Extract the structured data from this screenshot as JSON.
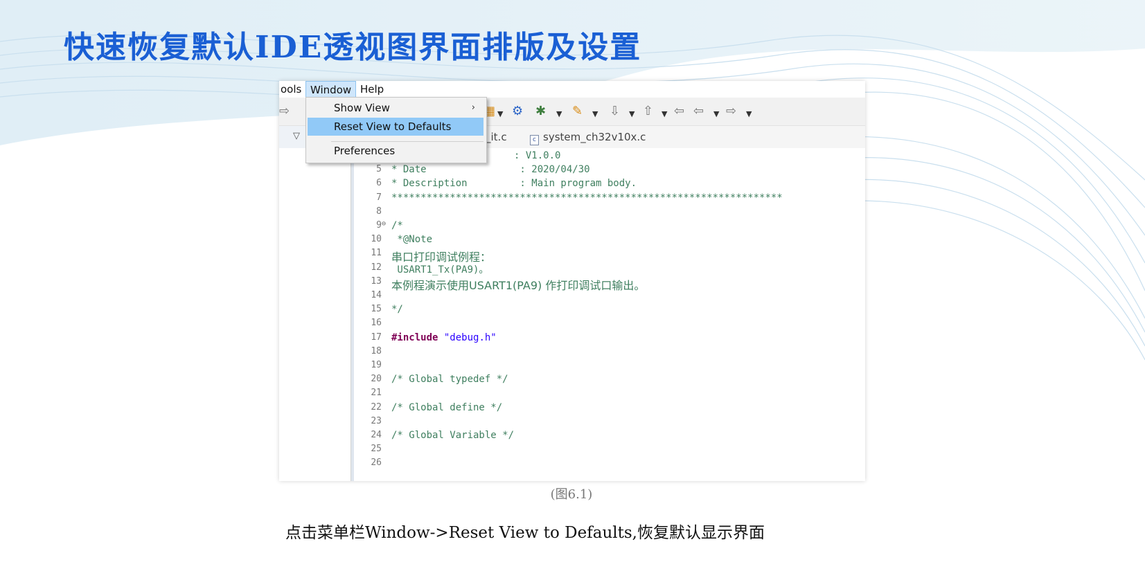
{
  "slide": {
    "title": "快速恢复默认IDE透视图界面排版及设置",
    "figure_caption": "(图6.1)",
    "instruction": "点击菜单栏Window->Reset View to Defaults,恢复默认显示界面"
  },
  "menubar": {
    "items": [
      "ools",
      "Window",
      "Help"
    ],
    "active": "Window"
  },
  "window_menu": {
    "items": [
      {
        "label": "Show View",
        "submenu": true
      },
      {
        "label": "Reset View to Defaults",
        "selected": true
      },
      {
        "label": "Preferences"
      }
    ]
  },
  "tabs": [
    "_it.c",
    "system_ch32v10x.c"
  ],
  "file_icon_glyph": "c",
  "icons": {
    "toolbar": [
      "redo-icon",
      "build-icon",
      "debug-icon",
      "tools-icon",
      "download-icon",
      "upload-icon",
      "back-icon",
      "forward-icon"
    ],
    "collapse": "collapse-triangle-icon"
  },
  "code_lines": [
    {
      "num": "",
      "text": "                     : V1.0.0"
    },
    {
      "num": "5",
      "text": "* Date                : 2020/04/30"
    },
    {
      "num": "6",
      "text": "* Description         : Main program body."
    },
    {
      "num": "7",
      "text": "*******************************************************************"
    },
    {
      "num": "8",
      "text": ""
    },
    {
      "num": "9",
      "text": "/*",
      "fold": "⊖"
    },
    {
      "num": "10",
      "text": " *@Note"
    },
    {
      "num": "11",
      "text": "串口打印调试例程：",
      "cn": true
    },
    {
      "num": "12",
      "text": " USART1_Tx(PA9)。"
    },
    {
      "num": "13",
      "text": "本例程演示使用USART1(PA9) 作打印调试口输出。",
      "cn": true
    },
    {
      "num": "14",
      "text": ""
    },
    {
      "num": "15",
      "text": "*/"
    },
    {
      "num": "16",
      "text": ""
    },
    {
      "num": "17",
      "text": "",
      "include_kw": "#include",
      "include_str": "\"debug.h\""
    },
    {
      "num": "18",
      "text": ""
    },
    {
      "num": "19",
      "text": ""
    },
    {
      "num": "20",
      "text": "/* Global typedef */"
    },
    {
      "num": "21",
      "text": ""
    },
    {
      "num": "22",
      "text": "/* Global define */"
    },
    {
      "num": "23",
      "text": ""
    },
    {
      "num": "24",
      "text": "/* Global Variable */"
    },
    {
      "num": "25",
      "text": ""
    },
    {
      "num": "26",
      "text": ""
    }
  ],
  "colors": {
    "title": "#1a5fd4",
    "comment": "#3f7f5f",
    "keyword": "#7f0055",
    "string": "#2a00ff",
    "menu_highlight": "#91c9f7"
  }
}
